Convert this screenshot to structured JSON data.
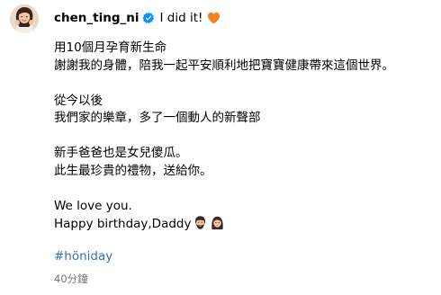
{
  "post": {
    "username": "chen_ting_ni",
    "verified": true,
    "header_text": "I did it!",
    "header_emoji": "orange-heart-icon",
    "caption_lines": [
      "用10個月孕育新生命",
      "謝謝我的身體，陪我一起平安順利地把寶寶健康帶來這個世界。",
      "",
      "從今以後",
      "我們家的樂章，多了一個動人的新聲部",
      "",
      "新手爸爸也是女兒傻瓜。",
      "此生最珍貴的禮物，送給你。",
      "",
      "We love you.",
      "Happy birthday,Daddy"
    ],
    "trailing_emojis": [
      "man-with-beard-icon",
      "girl-with-long-hair-icon"
    ],
    "hashtag": "#höniday",
    "timestamp": "40分鐘"
  },
  "colors": {
    "verified_blue": "#0095f6",
    "heart_orange": "#f4801f",
    "hashtag_link": "#3a6fb3",
    "timestamp_gray": "#737373"
  }
}
